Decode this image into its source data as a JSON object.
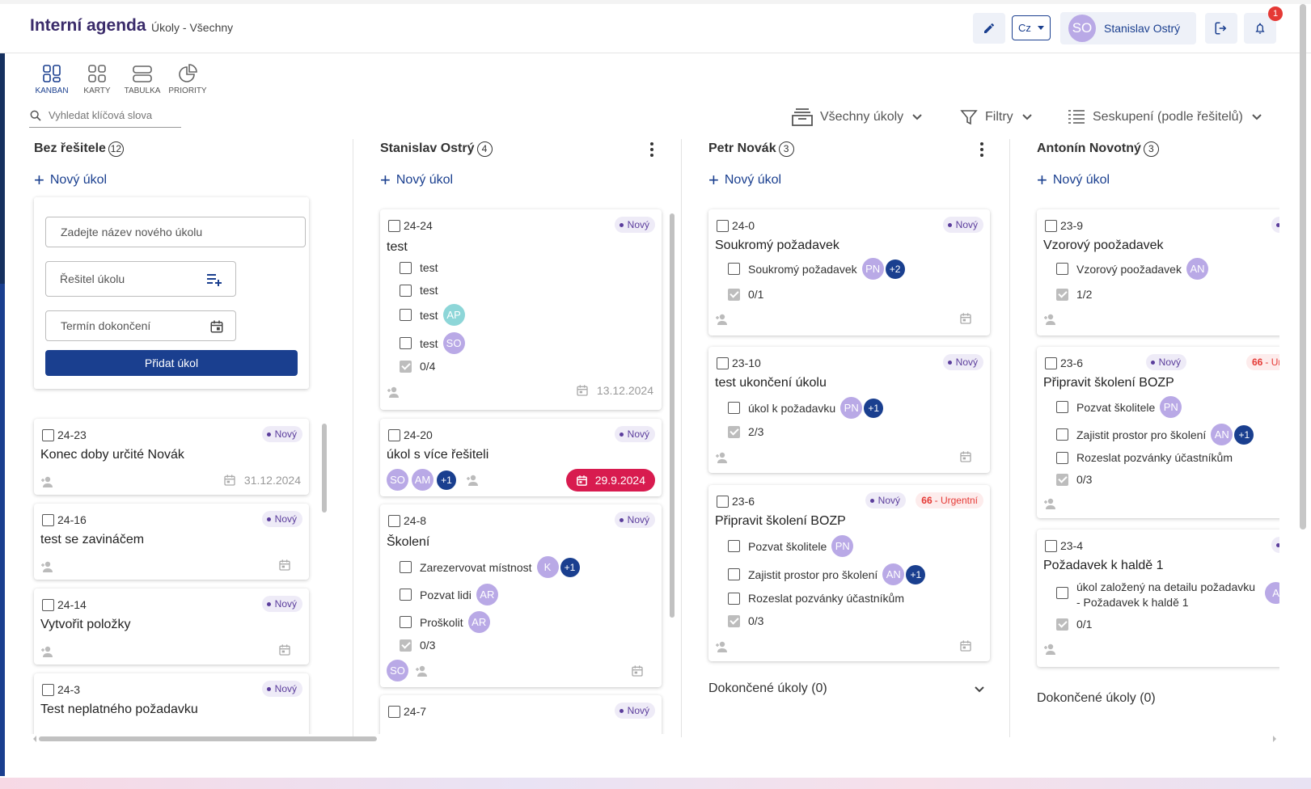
{
  "header": {
    "title": "Interní agenda",
    "subtitle": "Úkoly - Všechny",
    "language": "Cz",
    "user_initials": "SO",
    "user_name": "Stanislav Ostrý",
    "notification_count": "1"
  },
  "views": [
    {
      "label": "KANBAN",
      "icon": "kanban-icon"
    },
    {
      "label": "KARTY",
      "icon": "cards-icon"
    },
    {
      "label": "TABULKA",
      "icon": "table-icon"
    },
    {
      "label": "PRIORITY",
      "icon": "pie-icon"
    }
  ],
  "search": {
    "placeholder": "Vyhledat klíčová slova"
  },
  "filters": {
    "scope": "Všechny úkoly",
    "filter": "Filtry",
    "grouping": "Seskupení (podle řešitelů)"
  },
  "new_task_label": "Nový úkol",
  "status_new": "Nový",
  "urgent": {
    "num": "66",
    "label": "- Urgentní"
  },
  "urgent_short": {
    "num": "66",
    "label": "- Ur"
  },
  "done_label": "Dokončené úkoly (0)",
  "form": {
    "name_placeholder": "Zadejte název nového úkolu",
    "assignee_placeholder": "Řešitel úkolu",
    "deadline_placeholder": "Termín dokončení",
    "submit": "Přidat úkol"
  },
  "columns": [
    {
      "title": "Bez řešitele",
      "count": "12",
      "cards": [
        {
          "id": "24-23",
          "title": "Konec doby určité Novák",
          "date": "31.12.2024"
        },
        {
          "id": "24-16",
          "title": "test se zavináčem"
        },
        {
          "id": "24-14",
          "title": "Vytvořit položky"
        },
        {
          "id": "24-3",
          "title": "Test neplatného požadavku"
        }
      ]
    },
    {
      "title": "Stanislav Ostrý",
      "count": "4",
      "cards": [
        {
          "id": "24-24",
          "title": "test",
          "subtasks": [
            "test",
            "test",
            "test",
            "test"
          ],
          "sub_avatars": [
            "",
            "",
            "AP",
            "SO"
          ],
          "progress": "0/4",
          "date": "13.12.2024"
        },
        {
          "id": "24-20",
          "title": "úkol s více řešiteli",
          "avatars": [
            "SO",
            "AM"
          ],
          "extra": "+1",
          "date": "29.9.2024"
        },
        {
          "id": "24-8",
          "title": "Školení",
          "subtasks": [
            "Zarezervovat místnost",
            "Pozvat lidi",
            "Proškolit"
          ],
          "sub_avatars": [
            "K",
            "AR",
            "AR"
          ],
          "extra": "+1",
          "progress": "0/3",
          "avatar": "SO"
        },
        {
          "id": "24-7"
        }
      ]
    },
    {
      "title": "Petr Novák",
      "count": "3",
      "cards": [
        {
          "id": "24-0",
          "title": "Soukromý požadavek",
          "subtask": "Soukromý požadavek",
          "avatar": "PN",
          "extra": "+2",
          "progress": "0/1"
        },
        {
          "id": "23-10",
          "title": "test ukončení úkolu",
          "subtask": "úkol k požadavku",
          "avatar": "PN",
          "extra": "+1",
          "progress": "2/3"
        },
        {
          "id": "23-6",
          "title": "Připravit školení BOZP",
          "subtasks": [
            "Pozvat školitele",
            "Zajistit prostor pro školení",
            "Rozeslat pozvánky účastníkům"
          ],
          "sub_avatars": [
            "PN",
            "AN",
            ""
          ],
          "extra": "+1",
          "progress": "0/3"
        }
      ]
    },
    {
      "title": "Antonín Novotný",
      "count": "3",
      "cards": [
        {
          "id": "23-9",
          "title": "Vzorový poožadavek",
          "subtask": "Vzorový poožadavek",
          "avatar": "AN",
          "progress": "1/2"
        },
        {
          "id": "23-6",
          "title": "Připravit školení BOZP",
          "subtasks": [
            "Pozvat školitele",
            "Zajistit prostor pro školení",
            "Rozeslat pozvánky účastníkům"
          ],
          "sub_avatars": [
            "PN",
            "AN",
            ""
          ],
          "extra": "+1",
          "progress": "0/3"
        },
        {
          "id": "23-4",
          "title": "Požadavek k haldě 1",
          "subtask_line1": "úkol založený na detailu požadavku",
          "subtask_line2": "- Požadavek k haldě 1",
          "avatar": "A",
          "progress": "0/1"
        }
      ]
    }
  ]
}
